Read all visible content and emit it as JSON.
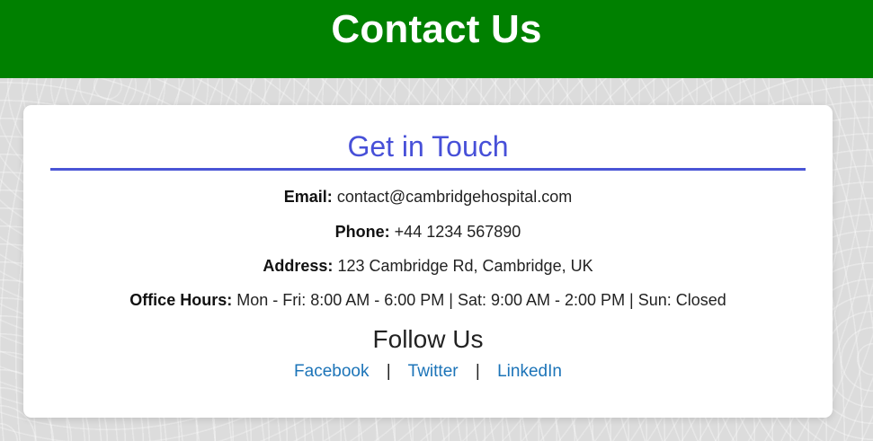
{
  "header": {
    "title": "Contact Us"
  },
  "card": {
    "title": "Get in Touch",
    "email": {
      "label": "Email:",
      "value": "contact@cambridgehospital.com"
    },
    "phone": {
      "label": "Phone:",
      "value": "+44 1234 567890"
    },
    "address": {
      "label": "Address:",
      "value": "123 Cambridge Rd, Cambridge, UK"
    },
    "hours": {
      "label": "Office Hours:",
      "value": "Mon - Fri: 8:00 AM - 6:00 PM | Sat: 9:00 AM - 2:00 PM | Sun: Closed"
    },
    "follow_title": "Follow Us",
    "social": [
      {
        "label": "Facebook"
      },
      {
        "label": "Twitter"
      },
      {
        "label": "LinkedIn"
      }
    ],
    "separator": "|"
  },
  "colors": {
    "header_bg": "#008000",
    "accent": "#4750d8",
    "link": "#1c74b8"
  }
}
